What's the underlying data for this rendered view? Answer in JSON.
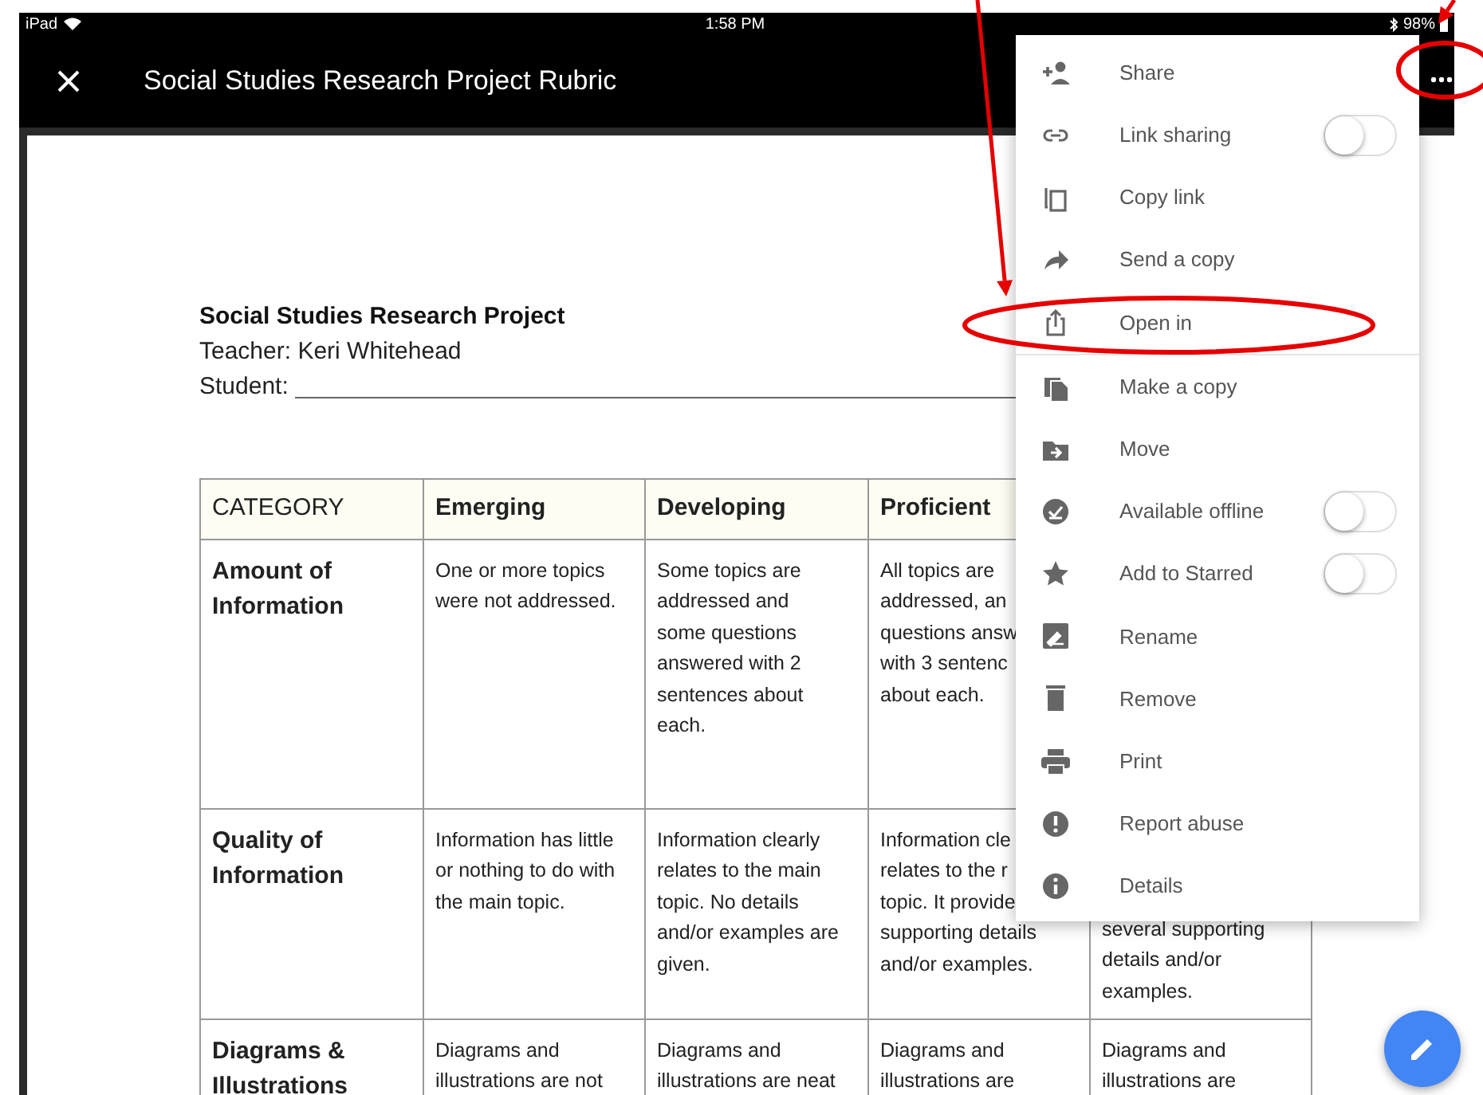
{
  "status_bar": {
    "device": "iPad",
    "time": "1:58 PM",
    "battery": "98%"
  },
  "app_bar": {
    "title": "Social Studies Research Project Rubric"
  },
  "document": {
    "title": "Social Studies Research Project",
    "teacher": "Teacher: Keri Whitehead",
    "student_label": "Student:",
    "table": {
      "columns": [
        "CATEGORY",
        "Emerging",
        "Developing",
        "Proficient"
      ],
      "rows": [
        {
          "cells": [
            [
              "Amount of",
              "Information"
            ],
            [
              "One or more topics",
              "were not addressed."
            ],
            [
              "Some topics are",
              "addressed and",
              "some questions",
              "answered with 2",
              "sentences about",
              "each."
            ],
            [
              "All topics are",
              "addressed, an",
              "questions answ",
              "with 3 sentenc",
              "about each."
            ]
          ]
        },
        {
          "cells": [
            [
              "Quality of",
              "Information"
            ],
            [
              "Information has little",
              "or nothing to do with",
              "the main topic."
            ],
            [
              "Information clearly",
              "relates to the main",
              "topic. No details",
              "and/or examples are",
              "given."
            ],
            [
              "Information cle",
              "relates to the r",
              "topic. It provide",
              "supporting details",
              "and/or examples."
            ],
            [
              "several supporting",
              "details and/or",
              "examples."
            ]
          ]
        },
        {
          "cells": [
            [
              "Diagrams &",
              "Illustrations"
            ],
            [
              "Diagrams and",
              "illustrations are not"
            ],
            [
              "Diagrams and",
              "illustrations are neat"
            ],
            [
              "Diagrams and",
              "illustrations are"
            ],
            [
              "Diagrams and",
              "illustrations are"
            ]
          ]
        }
      ]
    }
  },
  "menu": {
    "groups": [
      [
        {
          "label": "Share",
          "kind": "action"
        },
        {
          "label": "Link sharing",
          "kind": "toggle",
          "on": false
        },
        {
          "label": "Copy link",
          "kind": "action"
        },
        {
          "label": "Send a copy",
          "kind": "action"
        },
        {
          "label": "Open in",
          "kind": "action"
        }
      ],
      [
        {
          "label": "Make a copy",
          "kind": "action"
        },
        {
          "label": "Move",
          "kind": "action"
        },
        {
          "label": "Available offline",
          "kind": "toggle",
          "on": false
        },
        {
          "label": "Add to Starred",
          "kind": "toggle",
          "on": false
        },
        {
          "label": "Rename",
          "kind": "action"
        },
        {
          "label": "Remove",
          "kind": "action"
        },
        {
          "label": "Print",
          "kind": "action"
        },
        {
          "label": "Report abuse",
          "kind": "action"
        },
        {
          "label": "Details",
          "kind": "action"
        }
      ]
    ]
  },
  "annotations": [
    {
      "kind": "arrow"
    },
    {
      "kind": "arrow"
    },
    {
      "kind": "ellipse"
    },
    {
      "kind": "ellipse"
    }
  ]
}
